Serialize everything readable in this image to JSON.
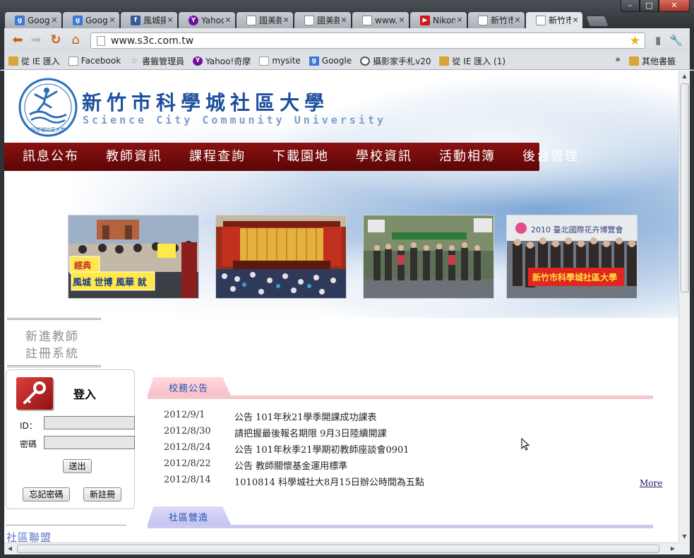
{
  "browser": {
    "window_controls": [
      "–",
      "□",
      "✕"
    ],
    "tabs": [
      {
        "title": "Goog",
        "favicon": "g-icon"
      },
      {
        "title": "Goog",
        "favicon": "g-icon"
      },
      {
        "title": "風城揚",
        "favicon": "facebook-icon"
      },
      {
        "title": "Yahoo",
        "favicon": "yahoo-icon"
      },
      {
        "title": "國美館",
        "favicon": "page-icon"
      },
      {
        "title": "國美館",
        "favicon": "page-icon"
      },
      {
        "title": "www.n",
        "favicon": "page-icon"
      },
      {
        "title": "Nikon",
        "favicon": "youtube-icon"
      },
      {
        "title": "新竹市",
        "favicon": "page-icon"
      },
      {
        "title": "新竹市",
        "favicon": "page-icon",
        "active": true
      }
    ],
    "tab_close_glyph": "✕",
    "url": "www.s3c.com.tw",
    "bookmarks": [
      {
        "label": "從 IE 匯入",
        "icon": "folder-icon"
      },
      {
        "label": "Facebook",
        "icon": "page-icon"
      },
      {
        "label": "書籤管理員",
        "icon": "star-icon"
      },
      {
        "label": "Yahoo!奇摩",
        "icon": "yahoo-icon"
      },
      {
        "label": "mysite",
        "icon": "page-icon"
      },
      {
        "label": "Google",
        "icon": "g-icon"
      },
      {
        "label": "攝影家手札v20",
        "icon": "camera-icon"
      },
      {
        "label": "從 IE 匯入 (1)",
        "icon": "folder-icon"
      }
    ],
    "bookmarks_overflow": "»",
    "other_bookmarks": "其他書籤"
  },
  "site": {
    "title_zh": "新竹市科學城社區大學",
    "title_en": "Science City Community University",
    "logo_ring_text": "科學城社區大學",
    "nav": [
      "訊息公布",
      "教師資訊",
      "課程查詢",
      "下載園地",
      "學校資訊",
      "活動相簿",
      "後台管理"
    ],
    "photos": [
      {
        "name": "photo-parade",
        "banner_text": "風城 世博 風華 就",
        "sign_text": "經典"
      },
      {
        "name": "photo-auditorium",
        "banner_text": ""
      },
      {
        "name": "photo-group-court",
        "banner_text": ""
      },
      {
        "name": "photo-flora-expo",
        "banner_text": "新竹市科學城社區大學",
        "sign_text": "2010 臺北國際花卉博覽會"
      }
    ]
  },
  "sidebar": {
    "register_line1": "新進教師",
    "register_line2": "註冊系統",
    "login": {
      "title": "登入",
      "id_label": "ID：",
      "password_label": "密碼",
      "id_value": "",
      "password_value": "",
      "submit_label": "送出",
      "forgot_label": "忘記密碼",
      "register_label": "新註冊"
    },
    "alliance_label": "社區聯盟"
  },
  "notices": {
    "school_header": "校務公告",
    "items": [
      {
        "date": "2012/9/1",
        "title": "公告 101年秋21學季開課成功課表"
      },
      {
        "date": "2012/8/30",
        "title": "請把握最後報名期限 9月3日陸續開課"
      },
      {
        "date": "2012/8/24",
        "title": "公告 101年秋季21學期初教師座談會0901"
      },
      {
        "date": "2012/8/22",
        "title": "公告 教師關懷基金運用標準"
      },
      {
        "date": "2012/8/14",
        "title": "1010814 科學城社大8月15日辦公時間為五點"
      }
    ],
    "more_label": "More",
    "community_header": "社區營造"
  },
  "colors": {
    "nav_bg": "#7a0d0d",
    "title_blue": "#1d4f9e",
    "school_tab": "#f7c1c8",
    "community_tab": "#c4c4f0"
  }
}
